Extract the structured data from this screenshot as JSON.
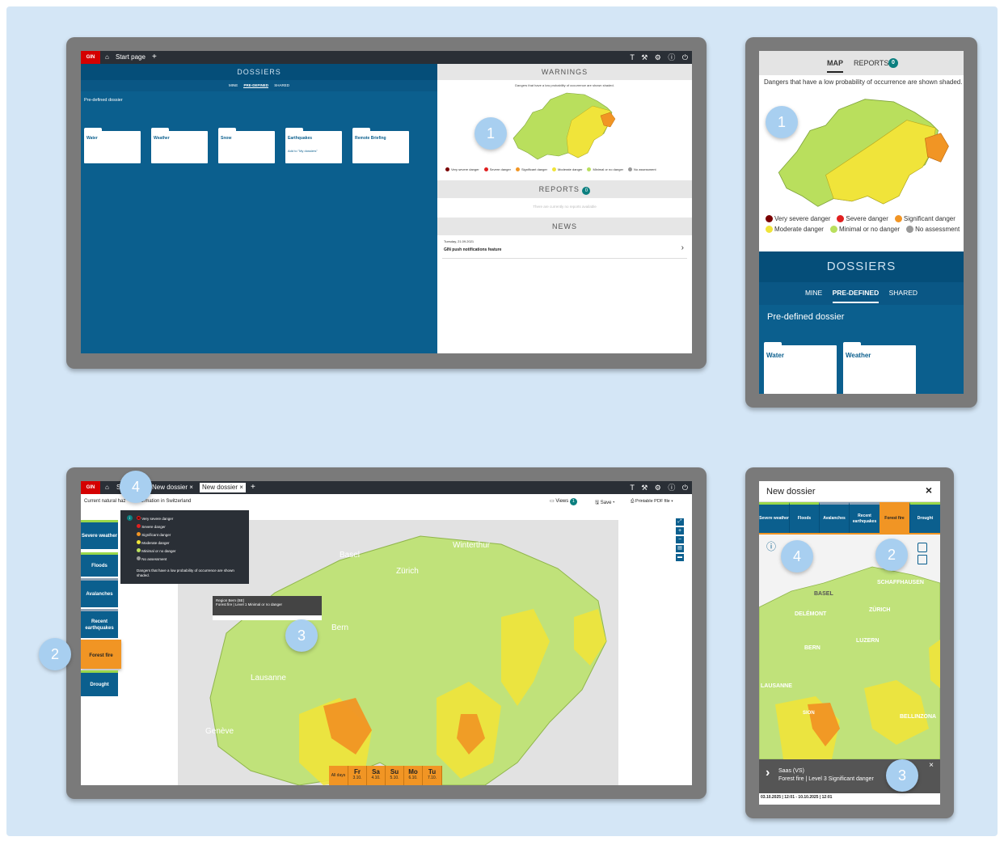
{
  "colors": {
    "background": "#d4e6f6",
    "brand_red": "#d40000",
    "dossier_blue": "#0b5f8e",
    "active_orange": "#f19524",
    "level_green": "#b9df5d",
    "level_yellow": "#f0e43a"
  },
  "markers": [
    "1",
    "1",
    "4",
    "2",
    "3",
    "4",
    "2",
    "3"
  ],
  "s1": {
    "gin": "GIN",
    "tab_start": "Start page",
    "tab_add": "+",
    "toolbar_icons": "T ⚒ ⚙ ⓘ ⏻",
    "dossiers_title": "DOSSIERS",
    "tabs": [
      "MINE",
      "PRE-DEFINED",
      "SHARED"
    ],
    "section_label": "Pre-defined dossier",
    "folders": [
      {
        "label": "Water",
        "sub": ""
      },
      {
        "label": "Weather",
        "sub": ""
      },
      {
        "label": "Snow",
        "sub": ""
      },
      {
        "label": "Earthquakes",
        "sub": "Add to \"My dossiers\""
      },
      {
        "label": "Remote Briefing",
        "sub": ""
      }
    ],
    "warnings_title": "WARNINGS",
    "warnings_note": "Dangers that have a low probability of occurrence are shown shaded.",
    "legend": [
      {
        "label": "Very severe danger",
        "color": "#7a0000"
      },
      {
        "label": "Severe danger",
        "color": "#e02020"
      },
      {
        "label": "Significant danger",
        "color": "#f19524"
      },
      {
        "label": "Moderate danger",
        "color": "#f0e43a"
      },
      {
        "label": "Minimal or no danger",
        "color": "#b9df5d"
      },
      {
        "label": "No assessment",
        "color": "#999999"
      }
    ],
    "reports_title": "REPORTS",
    "reports_count": "0",
    "reports_empty": "There are currently no reports available",
    "news_title": "NEWS",
    "news_date": "Tuesday, 21.09.2021",
    "news_item": "GIN push notifications feature",
    "news_chevron": "›"
  },
  "s2": {
    "tab_map": "MAP",
    "tab_reports": "REPORTS",
    "reports_count": "0",
    "note": "Dangers that have a low probability of occurrence are shown shaded.",
    "legend": [
      {
        "label": "Very severe danger",
        "color": "#7a0000"
      },
      {
        "label": "Severe danger",
        "color": "#e02020"
      },
      {
        "label": "Significant danger",
        "color": "#f19524"
      },
      {
        "label": "Moderate danger",
        "color": "#f0e43a"
      },
      {
        "label": "Minimal or no danger",
        "color": "#b9df5d"
      },
      {
        "label": "No assessment",
        "color": "#999999"
      }
    ],
    "dossiers_title": "DOSSIERS",
    "tabs": [
      "MINE",
      "PRE-DEFINED",
      "SHARED"
    ],
    "section_label": "Pre-defined dossier",
    "folders": [
      "Water",
      "Weather"
    ]
  },
  "s3": {
    "gin": "GIN",
    "tab_s": "S",
    "tab_dossier1": "New dossier ×",
    "tab_dossier2": "New dossier ×",
    "tab_add": "+",
    "toolbar_icons": "T ⚒ ⚙ ⓘ ⏻",
    "subtitle_a": "Current natural haz",
    "subtitle_b": "ormation in Switzerland",
    "views_label": "Views",
    "views_count": "1",
    "save_label": "Save ▾",
    "pdf_label": "Printable PDF file ▾",
    "categories": [
      "Severe weather",
      "Floods",
      "Avalanches",
      "Recent earthquakes",
      "Forest fire",
      "Drought"
    ],
    "legend_info": "i",
    "legend": [
      {
        "label": "Very severe danger",
        "color": "#7a0000"
      },
      {
        "label": "Severe danger",
        "color": "#e02020"
      },
      {
        "label": "Significant danger",
        "color": "#f19524"
      },
      {
        "label": "Moderate danger",
        "color": "#f0e43a"
      },
      {
        "label": "Minimal or no danger",
        "color": "#b9df5d"
      },
      {
        "label": "No assessment",
        "color": "#999999"
      }
    ],
    "legend_note": "Dangers that have a low probability of occurrence are shown shaded.",
    "tooltip_title": "Region Bern (BE)",
    "tooltip_text": "Forest fire | Level 1 Minimal or no danger",
    "cities": [
      "Basel",
      "Winterthur",
      "Zürich",
      "Bern",
      "Lausanne",
      "Genève"
    ],
    "days": [
      {
        "d": "All days",
        "n": ""
      },
      {
        "d": "Fr",
        "n": "3.10."
      },
      {
        "d": "Sa",
        "n": "4.10."
      },
      {
        "d": "Su",
        "n": "5.10."
      },
      {
        "d": "Mo",
        "n": "6.10."
      },
      {
        "d": "Tu",
        "n": "7.10."
      }
    ],
    "map_controls": [
      "⤢",
      "+",
      "−",
      "▤",
      "▬"
    ]
  },
  "s4": {
    "title": "New dossier",
    "close": "×",
    "categories": [
      "Severe weather",
      "Floods",
      "Avalanches",
      "Recent earthquakes",
      "Forest fire",
      "Drought"
    ],
    "info_icon": "ⓘ",
    "cities": [
      "SCHAFFHAUSEN",
      "BASEL",
      "ZÜRICH",
      "DELÉMONT",
      "LUZERN",
      "BERN",
      "LAUSANNE",
      "BELLINZONA",
      "SION"
    ],
    "alert_title": "Saas (VS)",
    "alert_text": "Forest fire | Level 3 Significant danger",
    "alert_chevron": "›",
    "alert_close": "×",
    "period": "03.10.2025 | 12:01 - 10.10.2025 | 12:01"
  }
}
